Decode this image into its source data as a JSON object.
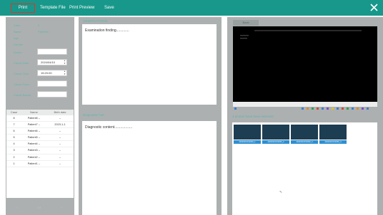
{
  "toolbar": {
    "print_label": "Print",
    "template_label": "Template File",
    "preview_label": "Print Preview",
    "save_label": "Save"
  },
  "patient_info": {
    "case_label": "Case",
    "case_value": "8",
    "name_label": "Name",
    "name_value": "Patient8",
    "age_label": "Age",
    "gender_label": "Gender",
    "doctor_label": "Doctor",
    "check_date_label": "Check Date",
    "check_date_value": "2024/04/10",
    "check_time_label": "Check Time",
    "check_time_value": "15:20:00",
    "check_from_label": "Check From",
    "check_result_label": "Check Result"
  },
  "case_table": {
    "headers": [
      "Case",
      "Name",
      "Birth date"
    ],
    "rows": [
      {
        "case": "8",
        "name": "Patient8 --",
        "birth": "--"
      },
      {
        "case": "7",
        "name": "Patient7 --",
        "birth": "2023-1-1"
      },
      {
        "case": "6",
        "name": "Patient6 --",
        "birth": "--"
      },
      {
        "case": "5",
        "name": "Patient5 --",
        "birth": "--"
      },
      {
        "case": "4",
        "name": "Patient4 --",
        "birth": "--"
      },
      {
        "case": "3",
        "name": "Patient3 --",
        "birth": "--"
      },
      {
        "case": "2",
        "name": "Patient2 --",
        "birth": "--"
      },
      {
        "case": "1",
        "name": "Patient1 --",
        "birth": "--"
      }
    ]
  },
  "pager": {
    "prev": "<",
    "page": "1/1",
    "next": ">"
  },
  "observations": {
    "title": "OBSERVATIONS",
    "text": "Examination finding............."
  },
  "diagnostic": {
    "title": "Diagnostic hint:",
    "text": "Diagnostic content.................."
  },
  "preview": {
    "header": "Back"
  },
  "photos": {
    "title": "4 photos have been selected",
    "items": [
      {
        "label": "20240410152000_1"
      },
      {
        "label": "20240410152000_2"
      },
      {
        "label": "20240410152000_3"
      },
      {
        "label": "20240410152000_4"
      }
    ]
  },
  "colors": {
    "toolbar_bg": "#17988a",
    "print_highlight": "#e4322b",
    "panel_bg": "#adb0b0",
    "label_teal": "#5fb5b1",
    "photo_label_bg": "#2f8fd0"
  },
  "icons": {
    "close": "close-icon",
    "spinner": "spinner-arrows-icon",
    "cursor": "mouse-cursor-icon"
  }
}
